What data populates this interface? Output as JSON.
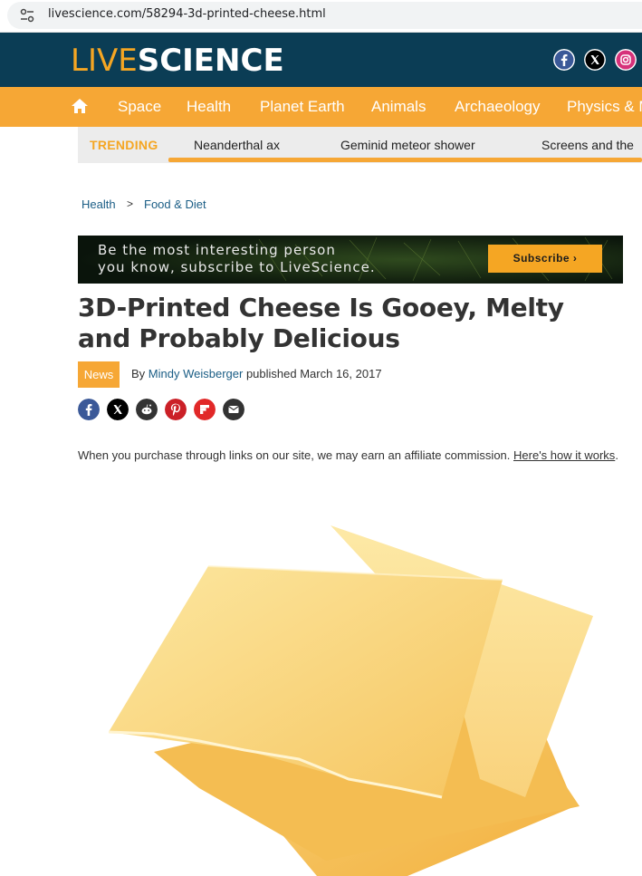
{
  "browser": {
    "url": "livescience.com/58294-3d-printed-cheese.html"
  },
  "header": {
    "logo_live": "LIVE",
    "logo_science": "SCIENCE",
    "social": [
      "facebook-icon",
      "x-icon",
      "instagram-icon"
    ]
  },
  "nav": {
    "items": [
      "Space",
      "Health",
      "Planet Earth",
      "Animals",
      "Archaeology",
      "Physics & M"
    ]
  },
  "trending": {
    "label": "TRENDING",
    "items": [
      "Neanderthal ax",
      "Geminid meteor shower",
      "Screens and the"
    ]
  },
  "breadcrumb": {
    "items": [
      "Health",
      "Food & Diet"
    ],
    "separator": ">"
  },
  "banner": {
    "line1": "Be the most interesting person",
    "line2": "you know, subscribe to LiveScience.",
    "button": "Subscribe ›"
  },
  "article": {
    "headline": "3D-Printed Cheese Is Gooey, Melty and Probably Delicious",
    "badge": "News",
    "by": "By",
    "author": "Mindy Weisberger",
    "published": "published March 16, 2017",
    "share_icons": [
      "facebook-icon",
      "x-icon",
      "reddit-icon",
      "pinterest-icon",
      "flipboard-icon",
      "email-icon"
    ],
    "affiliate_text": "When you purchase through links on our site, we may earn an affiliate commission.",
    "affiliate_link": "Here's how it works",
    "affiliate_end": "."
  },
  "colors": {
    "header_bg": "#0b3d55",
    "accent": "#f6a735",
    "link": "#1a5d85"
  }
}
